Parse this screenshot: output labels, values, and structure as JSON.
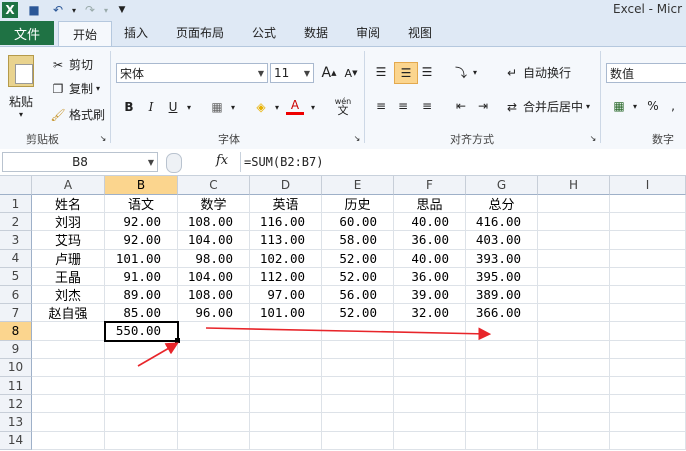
{
  "app": {
    "title": "Excel - Micr"
  },
  "quick_access": {
    "icons": [
      "excel-logo-icon",
      "save-icon",
      "undo-icon",
      "redo-icon",
      "customize-icon"
    ]
  },
  "tabs": {
    "file": "文件",
    "home": "开始",
    "insert": "插入",
    "page_layout": "页面布局",
    "formulas": "公式",
    "data": "数据",
    "review": "审阅",
    "view": "视图"
  },
  "ribbon": {
    "clipboard": {
      "paste": "粘贴",
      "cut": "剪切",
      "copy": "复制",
      "format_painter": "格式刷",
      "label": "剪贴板"
    },
    "font": {
      "name": "宋体",
      "size": "11",
      "bold": "B",
      "italic": "I",
      "underline": "U",
      "label": "字体",
      "wen": "wén",
      "wen_char": "文"
    },
    "alignment": {
      "wrap": "自动换行",
      "merge": "合并后居中",
      "label": "对齐方式"
    },
    "number": {
      "format": "数值",
      "label": "数字",
      "percent": "%"
    }
  },
  "formula_bar": {
    "name_box": "B8",
    "fx": "fx",
    "formula": "=SUM(B2:B7)"
  },
  "sheet": {
    "columns": [
      "A",
      "B",
      "C",
      "D",
      "E",
      "F",
      "G",
      "H",
      "I"
    ],
    "rows": [
      "1",
      "2",
      "3",
      "4",
      "5",
      "6",
      "7",
      "8",
      "9",
      "10",
      "11",
      "12",
      "13",
      "14"
    ],
    "selected_cell": "B8",
    "data": [
      [
        "姓名",
        "语文",
        "数学",
        "英语",
        "历史",
        "思品",
        "总分"
      ],
      [
        "刘羽",
        "92.00",
        "108.00",
        "116.00",
        "60.00",
        "40.00",
        "416.00"
      ],
      [
        "艾玛",
        "92.00",
        "104.00",
        "113.00",
        "58.00",
        "36.00",
        "403.00"
      ],
      [
        "卢珊",
        "101.00",
        "98.00",
        "102.00",
        "52.00",
        "40.00",
        "393.00"
      ],
      [
        "王晶",
        "91.00",
        "104.00",
        "112.00",
        "52.00",
        "36.00",
        "395.00"
      ],
      [
        "刘杰",
        "89.00",
        "108.00",
        "97.00",
        "56.00",
        "39.00",
        "389.00"
      ],
      [
        "赵自强",
        "85.00",
        "96.00",
        "101.00",
        "52.00",
        "32.00",
        "366.00"
      ]
    ],
    "b8_value": "550.00"
  },
  "annotations": {
    "arrow_color": "#e8252a"
  },
  "colors": {
    "file_tab": "#1f7244",
    "selected_header": "#fbd58e"
  }
}
